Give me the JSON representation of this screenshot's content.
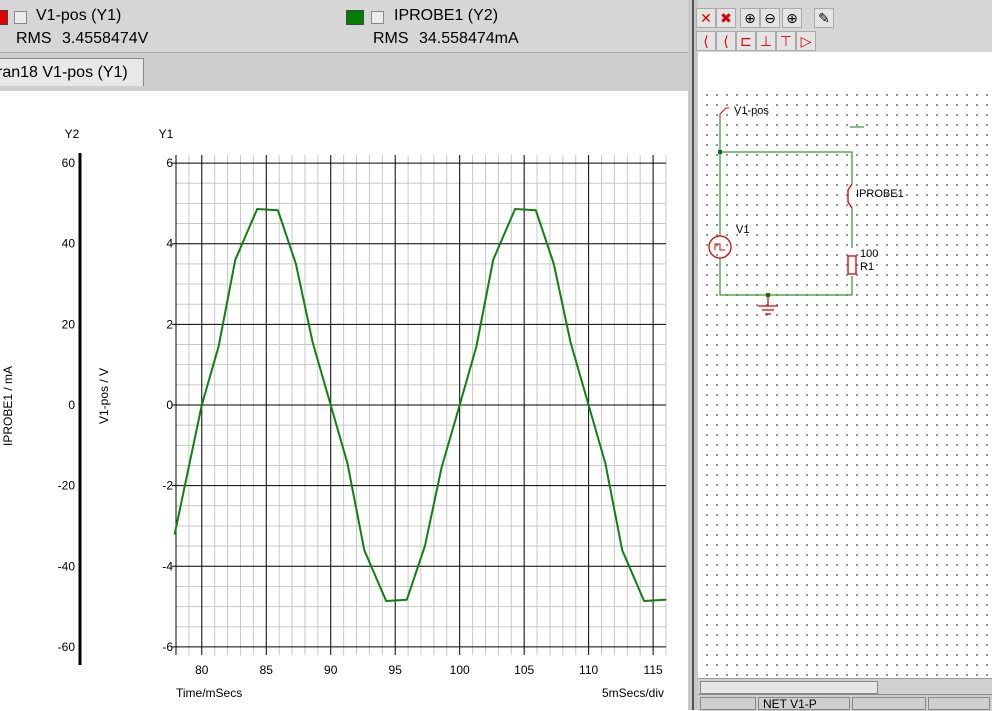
{
  "legend": {
    "trace1": {
      "name": "V1-pos (Y1)",
      "color": "#e00000",
      "rms_label": "RMS",
      "rms_value": "3.4558474V"
    },
    "trace2": {
      "name": "IPROBE1 (Y2)",
      "color": "#008000",
      "rms_label": "RMS",
      "rms_value": "34.558474mA"
    }
  },
  "tab": {
    "label": "ran18 V1-pos (Y1)"
  },
  "plot": {
    "y2_header": "Y2",
    "y1_header": "Y1",
    "y2_axis_label": "IPROBE1 / mA",
    "y1_axis_label": "V1-pos / V",
    "x_axis_label": "Time/mSecs",
    "x_scale_label": "5mSecs/div"
  },
  "chart_data": {
    "type": "line",
    "title": "",
    "xlabel": "Time/mSecs",
    "ylabel": "V1-pos / V",
    "y2label": "IPROBE1 / mA",
    "xlim": [
      78,
      116
    ],
    "ylim": [
      -6.2,
      6.2
    ],
    "y2lim": [
      -62,
      62
    ],
    "x_ticks": [
      "80",
      "85",
      "90",
      "95",
      "100",
      "105",
      "110",
      "115"
    ],
    "y_ticks": [
      "6",
      "4",
      "2",
      "0",
      "-2",
      "-4",
      "-6"
    ],
    "y2_ticks": [
      "60",
      "40",
      "20",
      "0",
      "-20",
      "-40",
      "-60"
    ],
    "grid": true,
    "series": [
      {
        "name": "V1-pos (Y1)",
        "color": "#108010",
        "x": [
          77.9,
          80,
          81.3,
          82.6,
          84.3,
          85.9,
          87.3,
          88.6,
          90,
          91.3,
          92.6,
          94.3,
          95.9,
          97.3,
          98.6,
          100,
          101.3,
          102.6,
          104.3,
          105.9,
          107.3,
          108.6,
          110,
          111.3,
          112.6,
          114.3,
          115.9,
          116
        ],
        "values": [
          -3.2,
          0,
          1.45,
          3.6,
          4.86,
          4.83,
          3.5,
          1.55,
          0,
          -1.45,
          -3.6,
          -4.86,
          -4.83,
          -3.5,
          -1.55,
          0,
          1.45,
          3.6,
          4.86,
          4.83,
          3.5,
          1.55,
          0,
          -1.45,
          -3.6,
          -4.86,
          -4.83,
          -4.83
        ]
      }
    ]
  },
  "schematic": {
    "net_label": "V1-pos",
    "probe_label": "IPROBE1",
    "source_label": "V1",
    "resistor_value": "100",
    "resistor_label": "R1"
  },
  "status": {
    "cell1": "",
    "cell2": "NET V1-P",
    "cell3": ""
  }
}
